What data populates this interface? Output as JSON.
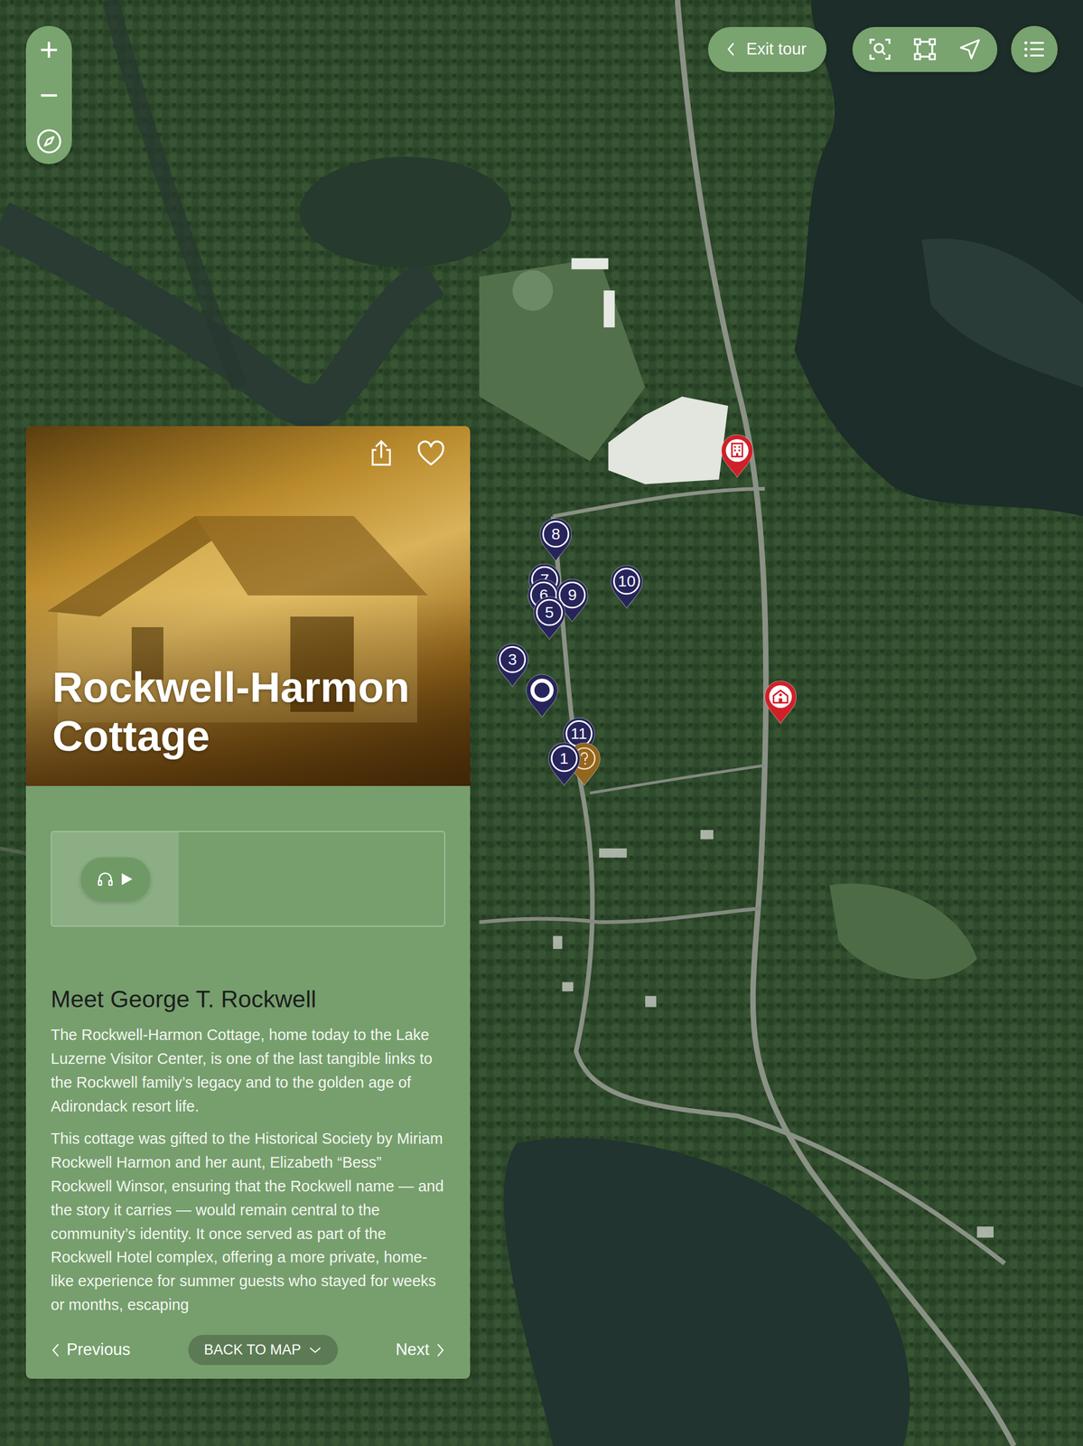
{
  "map_controls": {
    "zoom_in": "+",
    "zoom_out": "−"
  },
  "toolbar": {
    "exit_tour": "Exit tour"
  },
  "pins": [
    {
      "kind": "stop",
      "label": "7"
    },
    {
      "kind": "stop",
      "label": "6"
    },
    {
      "kind": "stop",
      "label": "8"
    },
    {
      "kind": "stop",
      "label": "9"
    },
    {
      "kind": "stop",
      "label": "5"
    },
    {
      "kind": "stop",
      "label": "10"
    },
    {
      "kind": "stop",
      "label": "3"
    },
    {
      "kind": "current"
    },
    {
      "kind": "stop",
      "label": "11"
    },
    {
      "kind": "info"
    },
    {
      "kind": "stop",
      "label": "1"
    },
    {
      "kind": "hotel"
    },
    {
      "kind": "landmark"
    }
  ],
  "stop": {
    "title": "Rockwell-Harmon Cottage",
    "favorite": false,
    "audio_playing": false,
    "section_title": "Meet George T. Rockwell",
    "paragraphs": [
      "The Rockwell-Harmon Cottage, home today to the Lake Luzerne Visitor Center, is one of the last tangible links to the Rockwell family’s legacy and to the golden age of Adirondack resort life.",
      "This cottage was gifted to the Historical Society by Miriam Rockwell Harmon and her aunt, Elizabeth “Bess” Rockwell Winsor, ensuring that the Rockwell name — and the story it carries — would remain central to the community’s identity. It once served as part of the Rockwell Hotel complex, offering a more private, home-like experience for summer guests who stayed for weeks or months, escaping"
    ]
  },
  "footer": {
    "previous": "Previous",
    "back": "BACK TO MAP",
    "next": "Next"
  }
}
